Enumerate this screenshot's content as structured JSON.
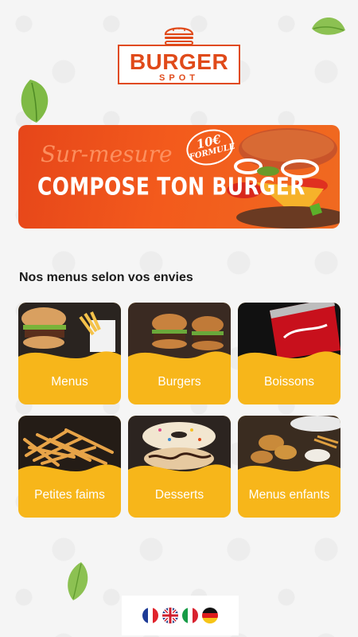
{
  "brand": {
    "name": "BURGER",
    "tagline": "SPOT",
    "accent_color": "#e04a1a"
  },
  "banner": {
    "script_text": "Sur-mesure",
    "title": "COMPOSE TON BURGER",
    "badge_price": "10€",
    "badge_label": "FORMULE",
    "background_color": "#f35a1c"
  },
  "section": {
    "title": "Nos menus selon vos envies"
  },
  "categories": [
    {
      "label": "Menus",
      "icon": "burger-fries-photo"
    },
    {
      "label": "Burgers",
      "icon": "burgers-photo"
    },
    {
      "label": "Boissons",
      "icon": "cola-can-photo"
    },
    {
      "label": "Petites faims",
      "icon": "fries-photo"
    },
    {
      "label": "Desserts",
      "icon": "donuts-photo"
    },
    {
      "label": "Menus enfants",
      "icon": "nuggets-photo"
    }
  ],
  "card_color": "#f7b61a",
  "languages": [
    {
      "code": "fr",
      "icon": "france-flag-icon"
    },
    {
      "code": "en",
      "icon": "uk-flag-icon"
    },
    {
      "code": "it",
      "icon": "italy-flag-icon"
    },
    {
      "code": "de",
      "icon": "germany-flag-icon"
    }
  ]
}
